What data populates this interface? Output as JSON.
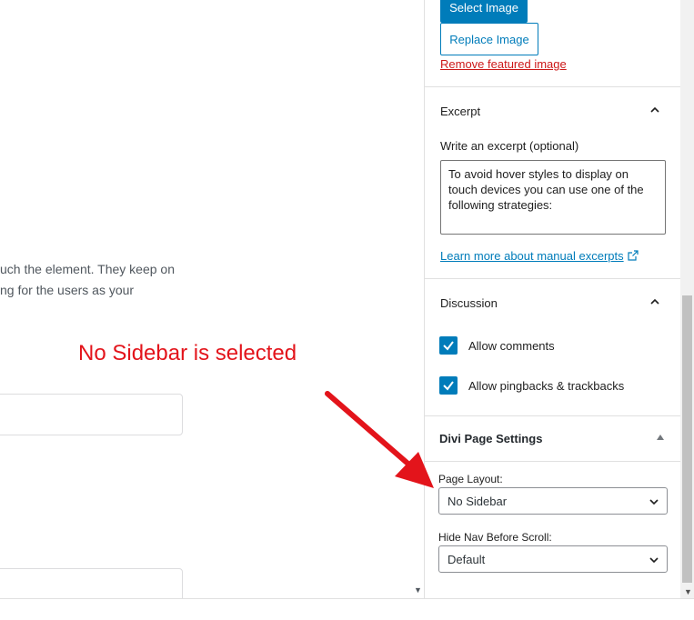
{
  "editor": {
    "body_lines": [
      "uch the element. They keep on",
      "ng for the users as your"
    ]
  },
  "annotation": {
    "callout": "No Sidebar is selected",
    "color": "#e3141b"
  },
  "featured_image": {
    "select_label": "Select Image",
    "replace_label": "Replace Image",
    "remove_label": "Remove featured image"
  },
  "excerpt": {
    "title": "Excerpt",
    "field_label": "Write an excerpt (optional)",
    "value": "To avoid hover styles to display on touch devices you can use one of the following strategies:",
    "help_link": "Learn more about manual excerpts"
  },
  "discussion": {
    "title": "Discussion",
    "allow_comments": "Allow comments",
    "allow_pingbacks": "Allow pingbacks & trackbacks"
  },
  "divi": {
    "title": "Divi Page Settings",
    "page_layout_label": "Page Layout:",
    "page_layout_value": "No Sidebar",
    "hide_nav_label": "Hide Nav Before Scroll:",
    "hide_nav_value": "Default"
  },
  "colors": {
    "accent": "#007cba",
    "danger": "#cc1818"
  },
  "icons": {
    "chevron_up": "chevron-up-icon",
    "chevron_down": "chevron-down-icon",
    "external": "external-link-icon",
    "check": "checkmark-icon"
  }
}
